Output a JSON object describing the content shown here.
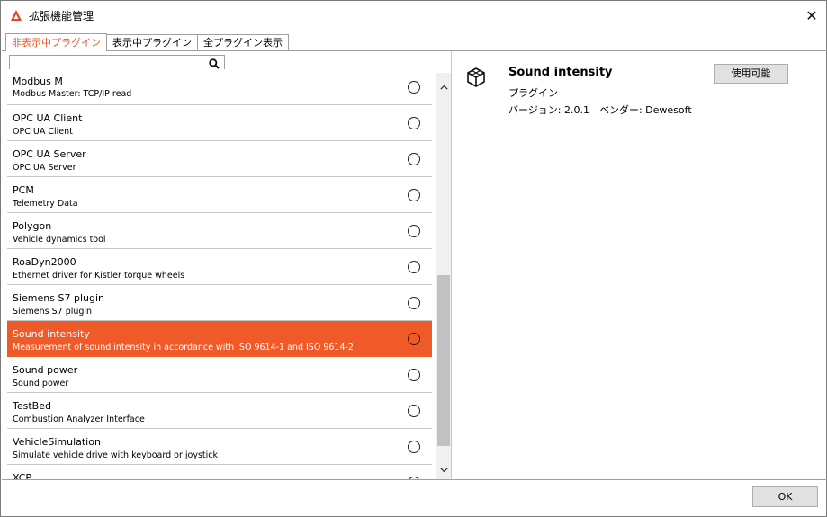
{
  "window": {
    "title": "拡張機能管理",
    "close_glyph": "✕"
  },
  "tabs": [
    {
      "label": "非表示中プラグイン",
      "active": true
    },
    {
      "label": "表示中プラグイン",
      "active": false
    },
    {
      "label": "全プラグイン表示",
      "active": false
    }
  ],
  "search": {
    "value": "",
    "placeholder": "",
    "icon": "search-icon"
  },
  "plugins": [
    {
      "name": "Modbus M",
      "description": "Modbus Master: TCP/IP read",
      "selected": false
    },
    {
      "name": "OPC UA Client",
      "description": "OPC UA Client",
      "selected": false
    },
    {
      "name": "OPC UA Server",
      "description": "OPC UA Server",
      "selected": false
    },
    {
      "name": "PCM",
      "description": "Telemetry Data",
      "selected": false
    },
    {
      "name": "Polygon",
      "description": "Vehicle dynamics tool",
      "selected": false
    },
    {
      "name": "RoaDyn2000",
      "description": "Ethernet driver for Kistler torque wheels",
      "selected": false
    },
    {
      "name": "Siemens S7 plugin",
      "description": "Siemens S7 plugin",
      "selected": false
    },
    {
      "name": "Sound intensity",
      "description": "Measurement of sound intensity in accordance with ISO 9614-1 and ISO 9614-2.",
      "selected": true
    },
    {
      "name": "Sound power",
      "description": "Sound power",
      "selected": false
    },
    {
      "name": "TestBed",
      "description": "Combustion Analyzer Interface",
      "selected": false
    },
    {
      "name": "VehicleSimulation",
      "description": "Simulate vehicle drive with keyboard or joystick",
      "selected": false
    },
    {
      "name": "XCP",
      "description": "",
      "selected": false
    }
  ],
  "detail": {
    "title": "Sound intensity",
    "type": "プラグイン",
    "version_line": "バージョン: 2.0.1　ベンダー: Dewesoft",
    "enable_button": "使用可能",
    "icon": "cube-icon"
  },
  "footer": {
    "ok_label": "OK"
  },
  "colors": {
    "accent": "#f05a28",
    "active_tab_text": "#e8572a"
  }
}
